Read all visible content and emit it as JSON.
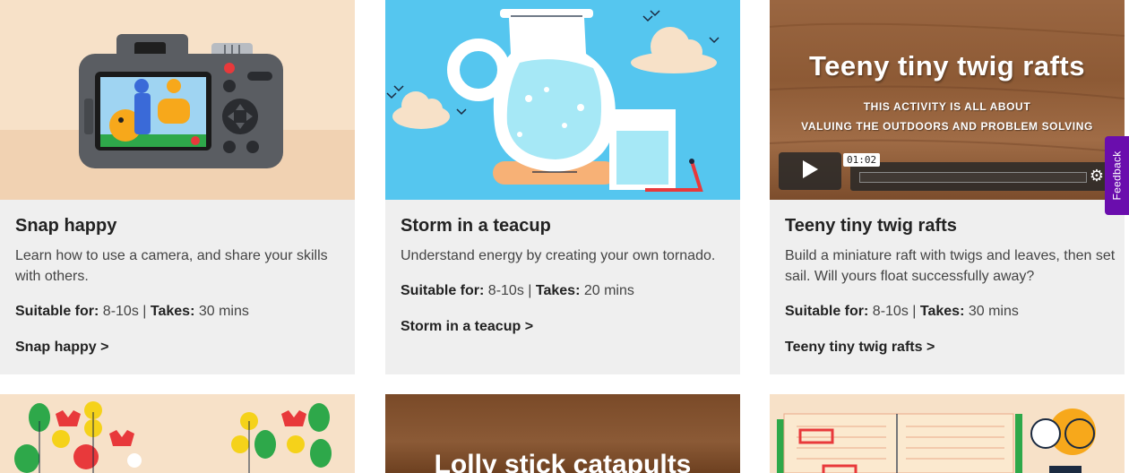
{
  "cards": [
    {
      "title": "Snap happy",
      "description": "Learn how to use a camera, and share your skills with others.",
      "suitable_label": "Suitable for:",
      "suitable_value": "8-10s",
      "separator": "|",
      "takes_label": "Takes:",
      "takes_value": "30 mins",
      "link": "Snap happy >"
    },
    {
      "title": "Storm in a teacup",
      "description": "Understand energy by creating your own tornado.",
      "suitable_label": "Suitable for:",
      "suitable_value": "8-10s",
      "separator": "|",
      "takes_label": "Takes:",
      "takes_value": "20 mins",
      "link": "Storm in a teacup >"
    },
    {
      "title": "Teeny tiny twig rafts",
      "description": "Build a miniature raft with twigs and leaves, then set sail. Will yours float successfully away?",
      "suitable_label": "Suitable for:",
      "suitable_value": "8-10s",
      "separator": "|",
      "takes_label": "Takes:",
      "takes_value": "30 mins",
      "link": "Teeny tiny twig rafts >"
    }
  ],
  "video": {
    "title": "Teeny tiny twig rafts",
    "subtitle_line1": "THIS ACTIVITY IS ALL ABOUT",
    "subtitle_line2": "VALUING THE OUTDOORS AND PROBLEM SOLVING",
    "time": "01:02",
    "play_icon": "play-icon",
    "settings_icon": "gear-icon"
  },
  "row2": {
    "catapult_title": "Lolly stick catapults"
  },
  "feedback": {
    "label": "Feedback",
    "color": "#6a0dad"
  },
  "colors": {
    "card_bg": "#efefef",
    "peach": "#f7e1c8",
    "sky": "#55c6ef",
    "wood": "#8b5a36"
  }
}
